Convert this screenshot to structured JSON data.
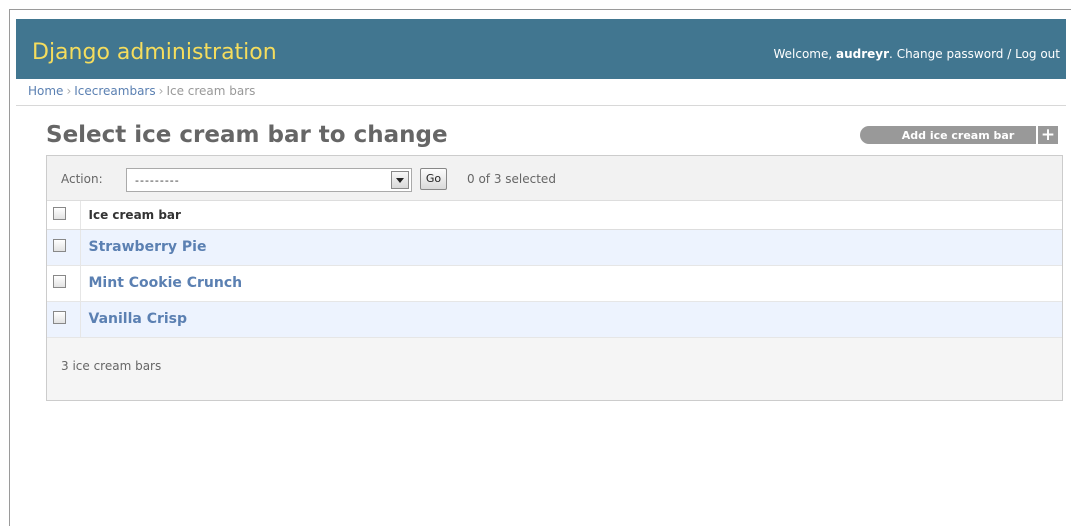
{
  "header": {
    "brand": "Django administration",
    "welcome": "Welcome, ",
    "username": "audreyr",
    "separator": ". ",
    "change_password": "Change password",
    "slash": " / ",
    "logout": "Log out"
  },
  "breadcrumbs": {
    "items": [
      "Home",
      "Icecreambars",
      "Ice cream bars"
    ],
    "separator": "›"
  },
  "page": {
    "title": "Select ice cream bar to change",
    "add_button": "Add ice cream bar",
    "add_icon": "+"
  },
  "actions": {
    "label": "Action:",
    "selected_value": "---------",
    "go_label": "Go",
    "selection_count": "0 of 3 selected"
  },
  "table": {
    "column_header": "Ice cream bar",
    "rows": [
      {
        "name": "Strawberry Pie",
        "checked": false
      },
      {
        "name": "Mint Cookie Crunch",
        "checked": false
      },
      {
        "name": "Vanilla Crisp",
        "checked": false
      }
    ]
  },
  "paginator": "3 ice cream bars",
  "colors": {
    "header_bg": "#417690",
    "brand": "#f5dd5d",
    "link": "#5b80b2",
    "row_alt": "#edf3fe"
  },
  "icons": {
    "select_arrow": "chevron-down-icon",
    "add": "plus-icon"
  }
}
